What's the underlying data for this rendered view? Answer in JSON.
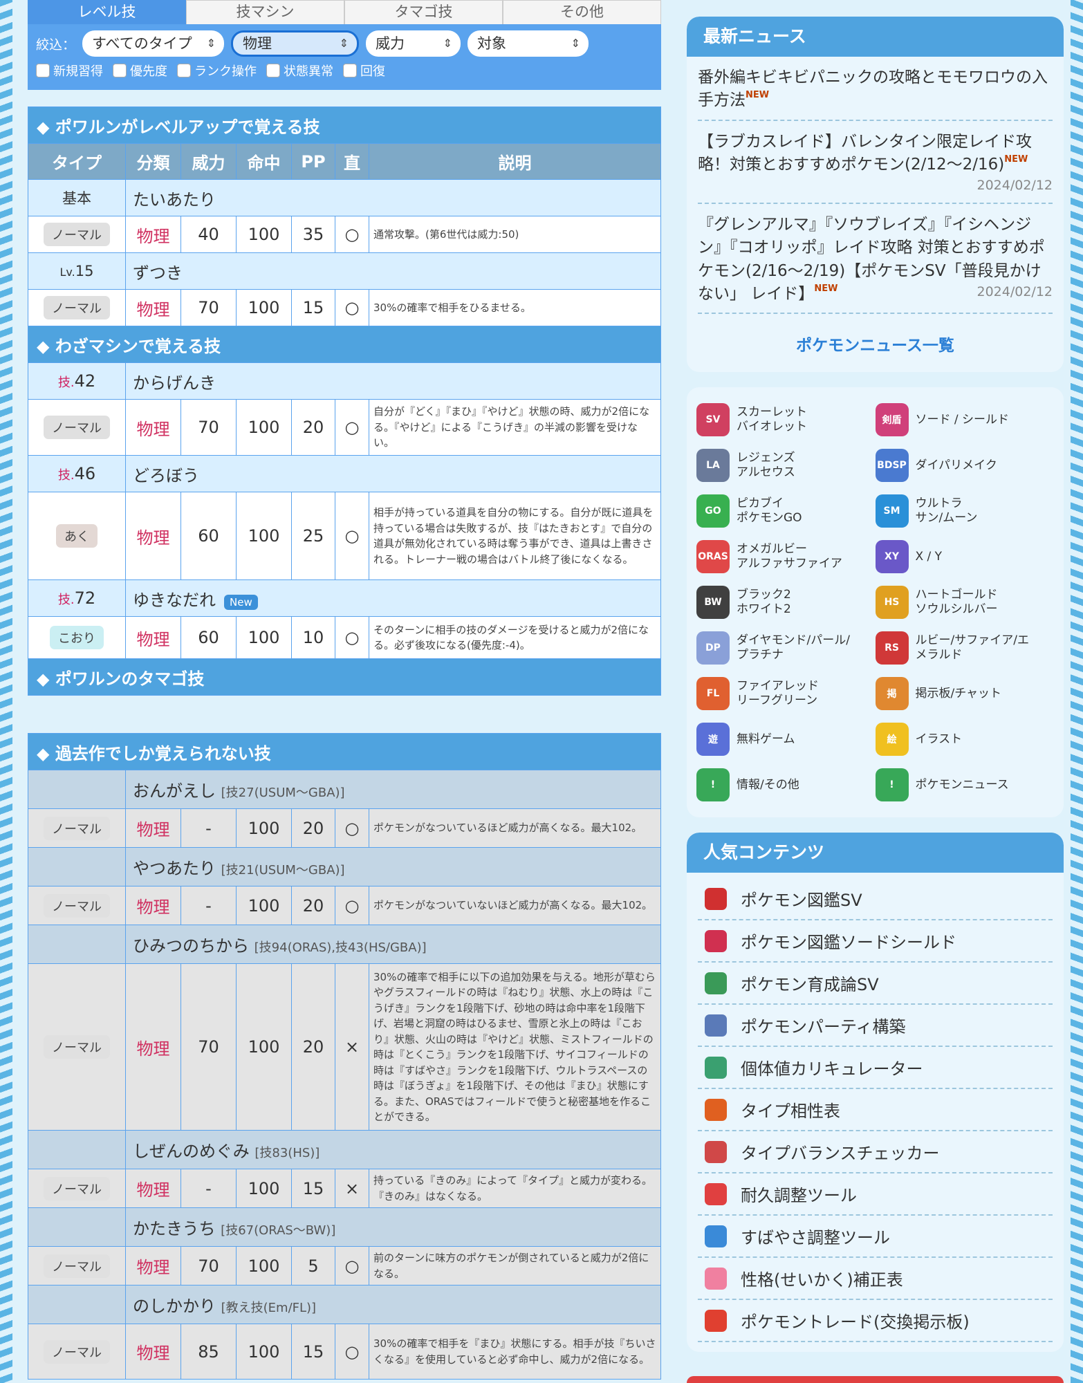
{
  "tabs": [
    "レベル技",
    "技マシン",
    "タマゴ技",
    "その他"
  ],
  "filter": {
    "label": "絞込：",
    "selects": [
      "すべてのタイプ",
      "物理",
      "威力",
      "対象"
    ],
    "checkboxes": [
      "新規習得",
      "優先度",
      "ランク操作",
      "状態異常",
      "回復"
    ]
  },
  "sections": {
    "level": "◆ ポワルンがレベルアップで覚える技",
    "tm": "◆ わざマシンで覚える技",
    "egg": "◆ ポワルンのタマゴ技",
    "past": "◆ 過去作でしか覚えられない技"
  },
  "headers": [
    "タイプ",
    "分類",
    "威力",
    "命中",
    "PP",
    "直",
    "説明"
  ],
  "level_moves": [
    {
      "lv_prefix": "",
      "lv": "基本",
      "name": "たいあたり",
      "type": "ノーマル",
      "cat": "物理",
      "pow": "40",
      "acc": "100",
      "pp": "35",
      "direct": "○",
      "desc": "通常攻撃。(第6世代は威力:50)"
    },
    {
      "lv_prefix": "Lv.",
      "lv": "15",
      "name": "ずつき",
      "type": "ノーマル",
      "cat": "物理",
      "pow": "70",
      "acc": "100",
      "pp": "15",
      "direct": "○",
      "desc": "30%の確率で相手をひるませる。"
    }
  ],
  "tm_moves": [
    {
      "prefix": "技.",
      "num": "42",
      "name": "からげんき",
      "new": "",
      "type": "ノーマル",
      "cat": "物理",
      "pow": "70",
      "acc": "100",
      "pp": "20",
      "direct": "○",
      "desc": "自分が『どく』『まひ』『やけど』状態の時、威力が2倍になる。『やけど』による『こうげき』の半減の影響を受けない。"
    },
    {
      "prefix": "技.",
      "num": "46",
      "name": "どろぼう",
      "new": "",
      "type": "あく",
      "cat": "物理",
      "pow": "60",
      "acc": "100",
      "pp": "25",
      "direct": "○",
      "desc": "相手が持っている道具を自分の物にする。自分が既に道具を持っている場合は失敗するが、技『はたきおとす』で自分の道具が無効化されている時は奪う事ができ、道具は上書きされる。トレーナー戦の場合はバトル終了後になくなる。"
    },
    {
      "prefix": "技.",
      "num": "72",
      "name": "ゆきなだれ",
      "new": "New",
      "type": "こおり",
      "cat": "物理",
      "pow": "60",
      "acc": "100",
      "pp": "10",
      "direct": "○",
      "desc": "そのターンに相手の技のダメージを受けると威力が2倍になる。必ず後攻になる(優先度:-4)。"
    }
  ],
  "past_moves": [
    {
      "name": "おんがえし",
      "hint": "[技27(USUM〜GBA)]",
      "type": "ノーマル",
      "cat": "物理",
      "pow": "-",
      "acc": "100",
      "pp": "20",
      "direct": "○",
      "desc": "ポケモンがなついているほど威力が高くなる。最大102。"
    },
    {
      "name": "やつあたり",
      "hint": "[技21(USUM〜GBA)]",
      "type": "ノーマル",
      "cat": "物理",
      "pow": "-",
      "acc": "100",
      "pp": "20",
      "direct": "○",
      "desc": "ポケモンがなついていないほど威力が高くなる。最大102。"
    },
    {
      "name": "ひみつのちから",
      "hint": "[技94(ORAS),技43(HS/GBA)]",
      "type": "ノーマル",
      "cat": "物理",
      "pow": "70",
      "acc": "100",
      "pp": "20",
      "direct": "×",
      "desc": "30%の確率で相手に以下の追加効果を与える。地形が草むらやグラスフィールドの時は『ねむり』状態、水上の時は『こうげき』ランクを1段階下げ、砂地の時は命中率を1段階下げ、岩場と洞窟の時はひるませ、雪原と氷上の時は『こおり』状態、火山の時は『やけど』状態、ミストフィールドの時は『とくこう』ランクを1段階下げ、サイコフィールドの時は『すばやさ』ランクを1段階下げ、ウルトラスペースの時は『ぼうぎょ』を1段階下げ、その他は『まひ』状態にする。また、ORASではフィールドで使うと秘密基地を作ることができる。"
    },
    {
      "name": "しぜんのめぐみ",
      "hint": "[技83(HS)]",
      "type": "ノーマル",
      "cat": "物理",
      "pow": "-",
      "acc": "100",
      "pp": "15",
      "direct": "×",
      "desc": "持っている『きのみ』によって『タイプ』と威力が変わる。『きのみ』はなくなる。"
    },
    {
      "name": "かたきうち",
      "hint": "[技67(ORAS〜BW)]",
      "type": "ノーマル",
      "cat": "物理",
      "pow": "70",
      "acc": "100",
      "pp": "5",
      "direct": "○",
      "desc": "前のターンに味方のポケモンが倒されていると威力が2倍になる。"
    },
    {
      "name": "のしかかり",
      "hint": "[教え技(Em/FL)]",
      "type": "ノーマル",
      "cat": "物理",
      "pow": "85",
      "acc": "100",
      "pp": "15",
      "direct": "○",
      "desc": "30%の確率で相手を『まひ』状態にする。相手が技『ちいさくなる』を使用していると必ず命中し、威力が2倍になる。"
    }
  ],
  "news": {
    "title": "最新ニュース",
    "items": [
      {
        "text": "番外編キビキビパニックの攻略とモモワロウの入手方法",
        "badge": "NEW",
        "date": ""
      },
      {
        "text": "【ラブカスレイド】バレンタイン限定レイド攻略！対策とおすすめポケモン(2/12〜2/16)",
        "badge": "NEW",
        "date": "2024/02/12"
      },
      {
        "text": "『グレンアルマ』『ソウブレイズ』『イシヘンジン』『コオリッポ』レイド攻略 対策とおすすめポケモン(2/16〜2/19)【ポケモンSV「普段見かけない」 レイド】",
        "badge": "NEW",
        "date": "2024/02/12"
      }
    ],
    "more": "ポケモンニュース一覧"
  },
  "games": [
    {
      "label": "スカーレット\nバイオレット",
      "icon": "SV",
      "color": "#d04060"
    },
    {
      "label": "ソード / シールド",
      "icon": "剣盾",
      "color": "#d0407a"
    },
    {
      "label": "レジェンズ\nアルセウス",
      "icon": "LA",
      "color": "#6a7a9a"
    },
    {
      "label": "ダイパリメイク",
      "icon": "BDSP",
      "color": "#4a7ad0"
    },
    {
      "label": "ピカブイ\nポケモンGO",
      "icon": "GO",
      "color": "#38b050"
    },
    {
      "label": "ウルトラ\nサン/ムーン",
      "icon": "SM",
      "color": "#2a90d8"
    },
    {
      "label": "オメガルビー\nアルファサファイア",
      "icon": "ORAS",
      "color": "#e04848"
    },
    {
      "label": "X / Y",
      "icon": "XY",
      "color": "#6a58c8"
    },
    {
      "label": "ブラック2\nホワイト2",
      "icon": "BW",
      "color": "#404040"
    },
    {
      "label": "ハートゴールド\nソウルシルバー",
      "icon": "HS",
      "color": "#e0a020"
    },
    {
      "label": "ダイヤモンド/パール/\nプラチナ",
      "icon": "DP",
      "color": "#8aa0d8"
    },
    {
      "label": "ルビー/サファイア/エ\nメラルド",
      "icon": "RS",
      "color": "#d03838"
    },
    {
      "label": "ファイアレッド\nリーフグリーン",
      "icon": "FL",
      "color": "#e06030"
    },
    {
      "label": "掲示板/チャット",
      "icon": "掲",
      "color": "#e08830"
    },
    {
      "label": "無料ゲーム",
      "icon": "遊",
      "color": "#5a70d8"
    },
    {
      "label": "イラスト",
      "icon": "絵",
      "color": "#f0c020"
    },
    {
      "label": "情報/その他",
      "icon": "!",
      "color": "#38a858"
    },
    {
      "label": "ポケモンニュース",
      "icon": "!",
      "color": "#38a858"
    }
  ],
  "popular": {
    "title": "人気コンテンツ",
    "items": [
      {
        "label": "ポケモン図鑑SV",
        "color": "#d03030"
      },
      {
        "label": "ポケモン図鑑ソードシールド",
        "color": "#d03050"
      },
      {
        "label": "ポケモン育成論SV",
        "color": "#3a9a58"
      },
      {
        "label": "ポケモンパーティ構築",
        "color": "#5a7ab8"
      },
      {
        "label": "個体値カリキュレーター",
        "color": "#3aa070"
      },
      {
        "label": "タイプ相性表",
        "color": "#e06020"
      },
      {
        "label": "タイプバランスチェッカー",
        "color": "#d04848"
      },
      {
        "label": "耐久調整ツール",
        "color": "#e04040"
      },
      {
        "label": "すばやさ調整ツール",
        "color": "#3a8ad8"
      },
      {
        "label": "性格(せいかく)補正表",
        "color": "#f080a0"
      },
      {
        "label": "ポケモントレード(交換掲示板)",
        "color": "#e04030"
      }
    ]
  }
}
